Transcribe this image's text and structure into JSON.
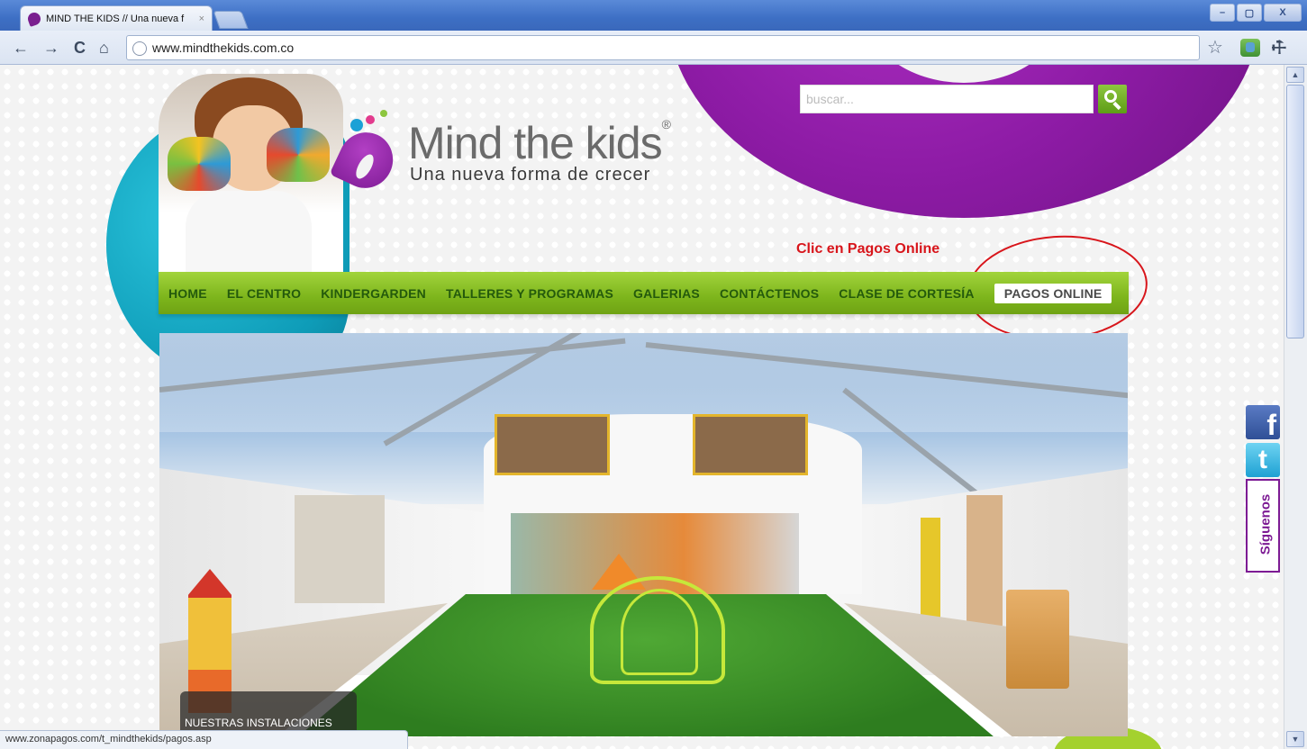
{
  "browser": {
    "tab_title": "MIND THE KIDS // Una nueva f",
    "tab_close": "×",
    "url": "www.mindthekids.com.co",
    "window_buttons": {
      "minimize": "–",
      "maximize": "▢",
      "close": "X"
    },
    "nav": {
      "back": "←",
      "forward": "→",
      "reload": "C",
      "home": "⌂"
    },
    "bookmark_star": "☆",
    "wrench": "🔧",
    "status_url": "www.zonapagos.com/t_mindthekids/pagos.asp"
  },
  "site": {
    "logo": {
      "brand_parts": [
        "Mind",
        " the ",
        "kids"
      ],
      "registered": "®",
      "tagline": "Una nueva forma de crecer"
    },
    "search": {
      "placeholder": "buscar..."
    },
    "annotation": "Clic en Pagos Online",
    "menu": [
      "HOME",
      "EL CENTRO",
      "KINDERGARDEN",
      "TALLERES Y PROGRAMAS",
      "GALERIAS",
      "CONTÁCTENOS",
      "CLASE DE CORTESÍA"
    ],
    "menu_active": "PAGOS ONLINE",
    "hero_caption": "NUESTRAS INSTALACIONES",
    "social": {
      "facebook": "f",
      "twitter": "t",
      "follow": "Síguenos"
    }
  },
  "colors": {
    "purple": "#7d1b94",
    "green_menu": "#8dc63f",
    "teal": "#0e9cb8",
    "annotation_red": "#d8151b"
  },
  "icons": [
    "globe-icon",
    "star-icon",
    "extension-icon",
    "wrench-icon",
    "search-icon",
    "facebook-icon",
    "twitter-icon"
  ]
}
